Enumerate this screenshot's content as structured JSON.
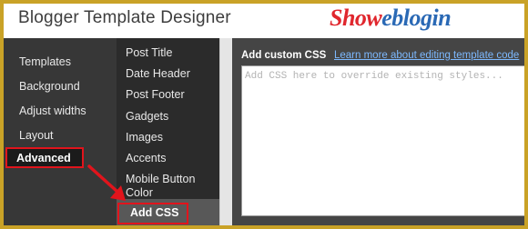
{
  "header": {
    "title": "Blogger Template Designer",
    "brand": {
      "part1": "Show",
      "part2": "eblogin",
      "color1": "#e0262d",
      "color2": "#2a69b5"
    }
  },
  "left_nav": {
    "items": [
      "Templates",
      "Background",
      "Adjust widths",
      "Layout"
    ],
    "active": "Advanced"
  },
  "sub_nav": {
    "items": [
      "Post Title",
      "Date Header",
      "Post Footer",
      "Gadgets",
      "Images",
      "Accents",
      "Mobile Button Color"
    ],
    "active": "Add CSS"
  },
  "panel": {
    "label": "Add custom CSS",
    "link": "Learn more about editing template code",
    "placeholder": "Add CSS here to override existing styles..."
  },
  "colors": {
    "highlight": "#e1141c",
    "frame": "#c9a227",
    "link": "#7db9ff"
  }
}
